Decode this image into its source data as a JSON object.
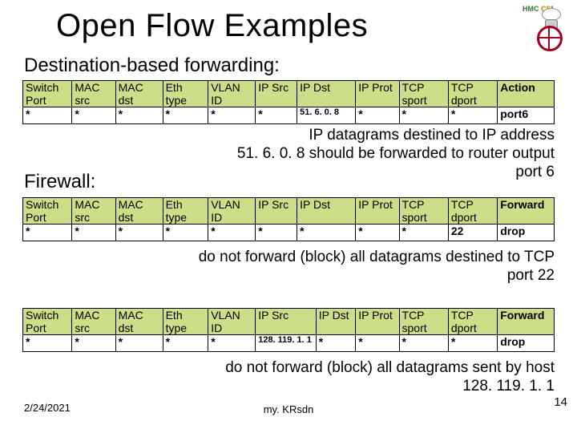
{
  "title": "Open Flow Examples",
  "subtitles": {
    "dest": "Destination-based forwarding:",
    "fw": "Firewall:"
  },
  "headers": {
    "col0": "Switch Port",
    "col1": "MAC src",
    "col2": "MAC dst",
    "col3": "Eth type",
    "col4": "VLAN ID",
    "col5": "IP Src",
    "col6": "IP Dst",
    "col7": "IP Prot",
    "col8": "TCP sport",
    "col9": "TCP dport",
    "action": "Action",
    "forward": "Forward"
  },
  "tables": {
    "t1": {
      "c0": "*",
      "c1": "*",
      "c2": "*",
      "c3": "*",
      "c4": "*",
      "c5": "*",
      "c6": "51. 6. 0. 8",
      "c7": "*",
      "c8": "*",
      "c9": "*",
      "act": "port6"
    },
    "t2": {
      "c0": "*",
      "c1": "*",
      "c2": "*",
      "c3": "*",
      "c4": "*",
      "c5": "*",
      "c6": "*",
      "c7": "*",
      "c8": "*",
      "c9": "22",
      "act": "drop"
    },
    "t3": {
      "c0": "*",
      "c1": "*",
      "c2": "*",
      "c3": "*",
      "c4": "*",
      "c5": "128. 119. 1. 1",
      "c6": "*",
      "c7": "*",
      "c8": "*",
      "c9": "*",
      "act": "drop"
    }
  },
  "captions": {
    "cap1a": "IP datagrams destined to IP address",
    "cap1b": "51. 6. 0. 8 should be forwarded to router output",
    "cap1c": "port 6",
    "cap2a": "do not forward (block) all datagrams destined to TCP",
    "cap2b": "port 22",
    "cap3a": "do not forward (block) all datagrams sent by host",
    "cap3b": "128. 119. 1. 1"
  },
  "footer": {
    "date": "2/24/2021",
    "center": "my. KRsdn",
    "page": "14"
  },
  "logo": {
    "label": "HMC CS!"
  }
}
